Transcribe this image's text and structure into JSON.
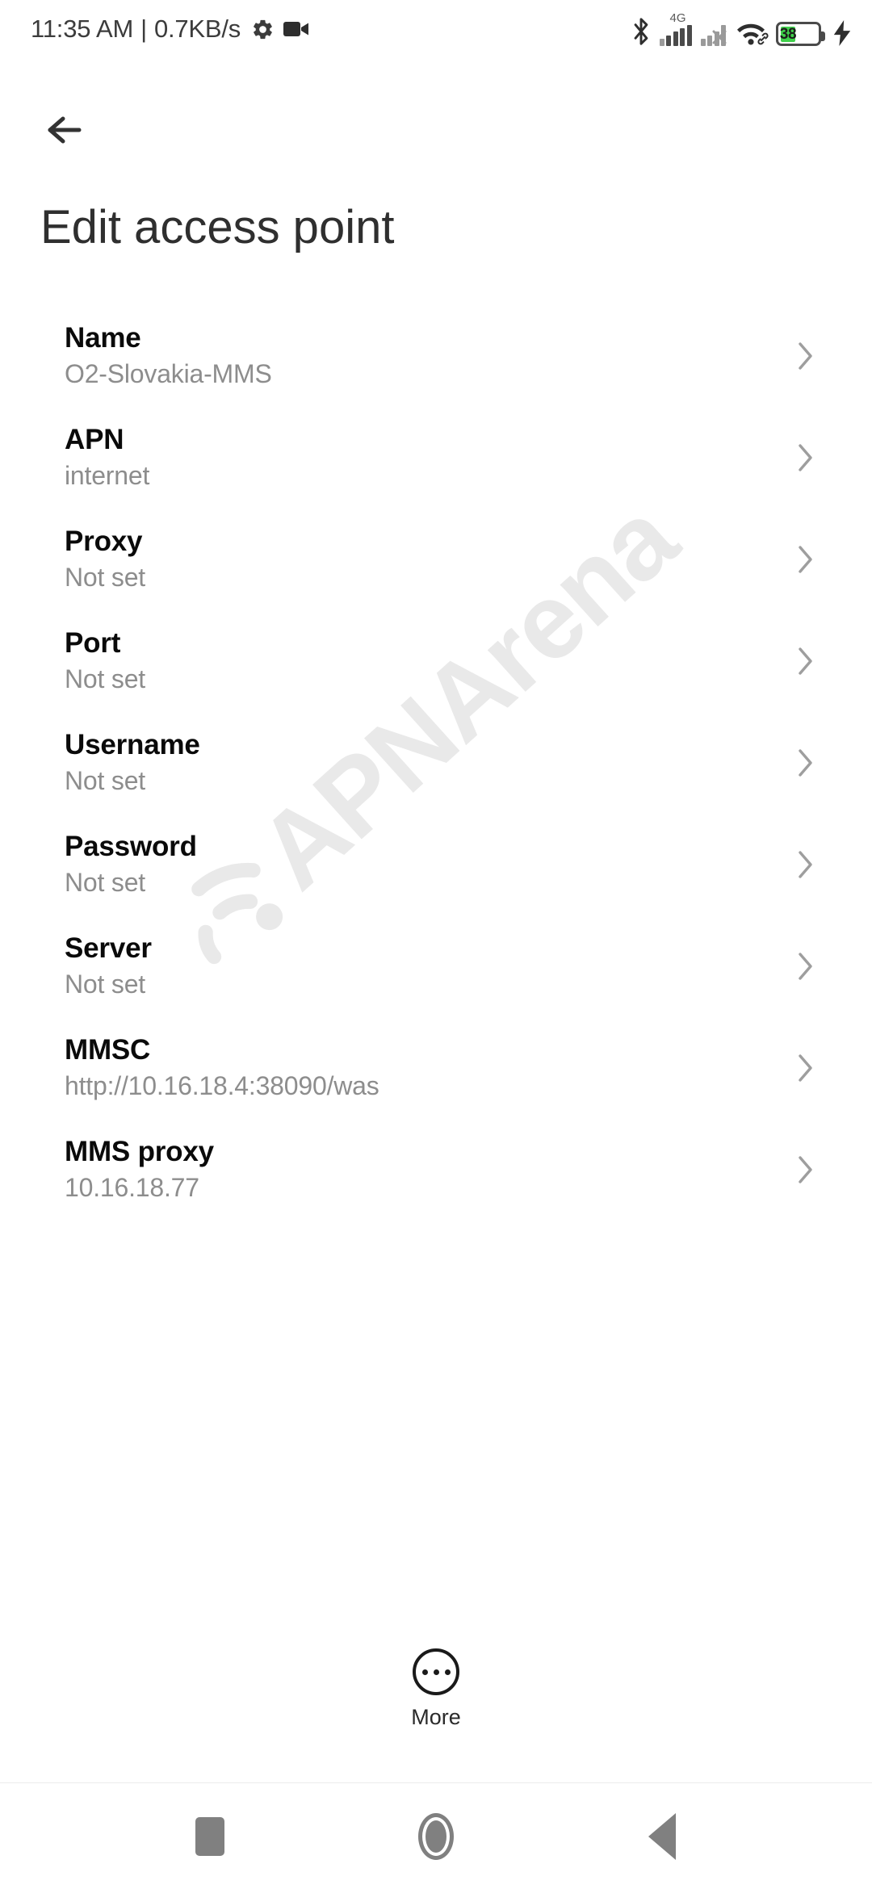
{
  "status_bar": {
    "time": "11:35 AM",
    "separator": "|",
    "network_speed": "0.7KB/s",
    "gear_icon": "gear-icon",
    "camera_icon": "video-camera-icon",
    "bluetooth_icon": "bluetooth-icon",
    "sim1_network_label": "4G",
    "sim1_signal_icon": "signal-bars-icon",
    "sim1_bars_filled": 4,
    "sim2_signal_icon": "signal-bars-no-service-icon",
    "sim2_bars_filled": 2,
    "wifi_icon": "wifi-icon",
    "wifi_link_icon": "link-icon",
    "battery_icon": "battery-icon",
    "battery_percent": "38",
    "battery_color": "#3fd04a",
    "charging_icon": "lightning-bolt-icon"
  },
  "header": {
    "back_icon": "arrow-left-icon",
    "title": "Edit access point"
  },
  "watermark": {
    "text": "APNArena",
    "logo_icon": "wifi-signal-icon",
    "color": "#e9e9e9"
  },
  "settings": {
    "rows": [
      {
        "label": "Name",
        "value": "O2-Slovakia-MMS",
        "chevron": "chevron-right-icon"
      },
      {
        "label": "APN",
        "value": "internet",
        "chevron": "chevron-right-icon"
      },
      {
        "label": "Proxy",
        "value": "Not set",
        "chevron": "chevron-right-icon"
      },
      {
        "label": "Port",
        "value": "Not set",
        "chevron": "chevron-right-icon"
      },
      {
        "label": "Username",
        "value": "Not set",
        "chevron": "chevron-right-icon"
      },
      {
        "label": "Password",
        "value": "Not set",
        "chevron": "chevron-right-icon"
      },
      {
        "label": "Server",
        "value": "Not set",
        "chevron": "chevron-right-icon"
      },
      {
        "label": "MMSC",
        "value": "http://10.16.18.4:38090/was",
        "chevron": "chevron-right-icon"
      },
      {
        "label": "MMS proxy",
        "value": "10.16.18.77",
        "chevron": "chevron-right-icon"
      }
    ]
  },
  "more_button": {
    "icon": "overflow-dots-icon",
    "label": "More"
  },
  "nav_bar": {
    "recents_icon": "square-recents-icon",
    "home_icon": "circle-home-icon",
    "back_icon": "triangle-back-icon"
  }
}
